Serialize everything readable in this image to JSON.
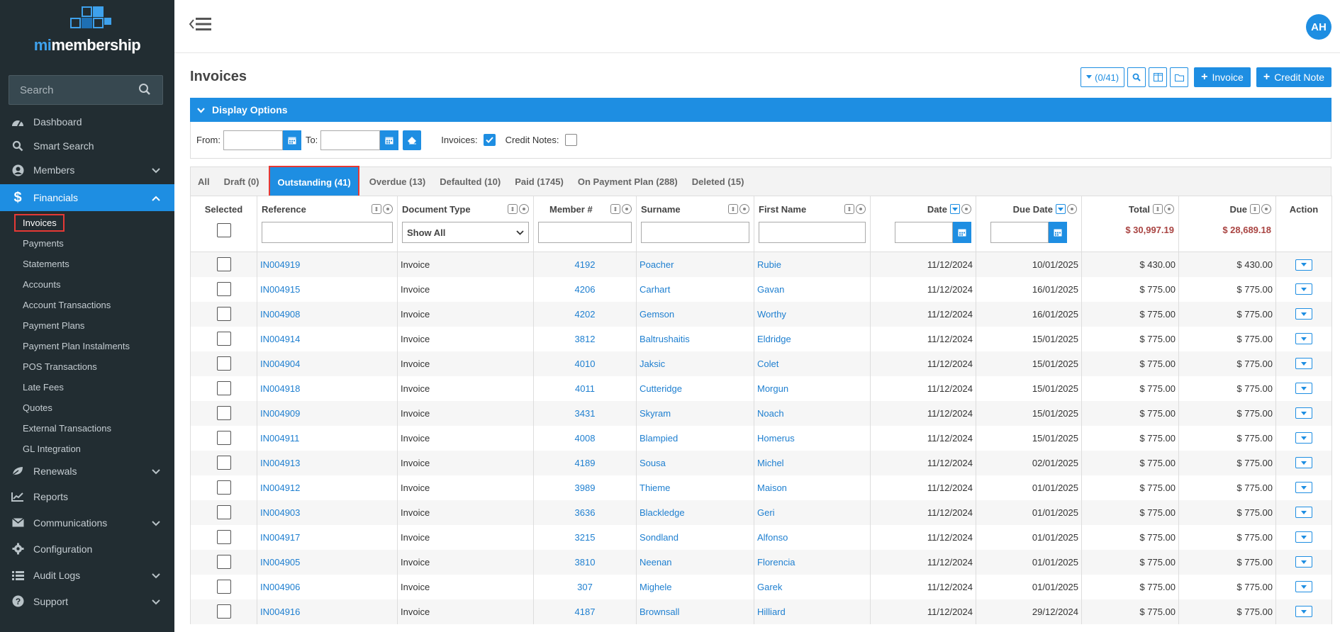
{
  "app": {
    "logo_mi": "mi",
    "logo_rest": "membership",
    "user_initials": "AH"
  },
  "search": {
    "placeholder": "Search"
  },
  "nav": {
    "dashboard": "Dashboard",
    "smart_search": "Smart Search",
    "members": "Members",
    "financials": "Financials",
    "renewals": "Renewals",
    "reports": "Reports",
    "communications": "Communications",
    "configuration": "Configuration",
    "audit_logs": "Audit Logs",
    "support": "Support",
    "financials_sub": [
      "Invoices",
      "Payments",
      "Statements",
      "Accounts",
      "Account Transactions",
      "Payment Plans",
      "Payment Plan Instalments",
      "POS Transactions",
      "Late Fees",
      "Quotes",
      "External Transactions",
      "GL Integration"
    ]
  },
  "page": {
    "title": "Invoices"
  },
  "toolbar": {
    "count_label": "(0/41)",
    "invoice_btn": "Invoice",
    "credit_note_btn": "Credit Note"
  },
  "display_options": {
    "title": "Display Options",
    "from": "From:",
    "to": "To:",
    "invoices_label": "Invoices:",
    "credit_notes_label": "Credit Notes:",
    "invoices_checked": true,
    "credit_notes_checked": false
  },
  "tabs": [
    "All",
    "Draft (0)",
    "Outstanding (41)",
    "Overdue (13)",
    "Defaulted (10)",
    "Paid (1745)",
    "On Payment Plan (288)",
    "Deleted (15)"
  ],
  "active_tab": "Outstanding (41)",
  "table": {
    "headers": {
      "selected": "Selected",
      "reference": "Reference",
      "document_type": "Document Type",
      "member": "Member #",
      "surname": "Surname",
      "first_name": "First Name",
      "date": "Date",
      "due_date": "Due Date",
      "total": "Total",
      "due": "Due",
      "action": "Action"
    },
    "document_type_filter": "Show All",
    "total_sum": "$ 30,997.19",
    "due_sum": "$ 28,689.18",
    "rows": [
      {
        "ref": "IN004919",
        "type": "Invoice",
        "member": "4192",
        "surname": "Poacher",
        "first": "Rubie",
        "date": "11/12/2024",
        "due_date": "10/01/2025",
        "total": "$ 430.00",
        "due": "$ 430.00"
      },
      {
        "ref": "IN004915",
        "type": "Invoice",
        "member": "4206",
        "surname": "Carhart",
        "first": "Gavan",
        "date": "11/12/2024",
        "due_date": "16/01/2025",
        "total": "$ 775.00",
        "due": "$ 775.00"
      },
      {
        "ref": "IN004908",
        "type": "Invoice",
        "member": "4202",
        "surname": "Gemson",
        "first": "Worthy",
        "date": "11/12/2024",
        "due_date": "16/01/2025",
        "total": "$ 775.00",
        "due": "$ 775.00"
      },
      {
        "ref": "IN004914",
        "type": "Invoice",
        "member": "3812",
        "surname": "Baltrushaitis",
        "first": "Eldridge",
        "date": "11/12/2024",
        "due_date": "15/01/2025",
        "total": "$ 775.00",
        "due": "$ 775.00"
      },
      {
        "ref": "IN004904",
        "type": "Invoice",
        "member": "4010",
        "surname": "Jaksic",
        "first": "Colet",
        "date": "11/12/2024",
        "due_date": "15/01/2025",
        "total": "$ 775.00",
        "due": "$ 775.00"
      },
      {
        "ref": "IN004918",
        "type": "Invoice",
        "member": "4011",
        "surname": "Cutteridge",
        "first": "Morgun",
        "date": "11/12/2024",
        "due_date": "15/01/2025",
        "total": "$ 775.00",
        "due": "$ 775.00"
      },
      {
        "ref": "IN004909",
        "type": "Invoice",
        "member": "3431",
        "surname": "Skyram",
        "first": "Noach",
        "date": "11/12/2024",
        "due_date": "15/01/2025",
        "total": "$ 775.00",
        "due": "$ 775.00"
      },
      {
        "ref": "IN004911",
        "type": "Invoice",
        "member": "4008",
        "surname": "Blampied",
        "first": "Homerus",
        "date": "11/12/2024",
        "due_date": "15/01/2025",
        "total": "$ 775.00",
        "due": "$ 775.00"
      },
      {
        "ref": "IN004913",
        "type": "Invoice",
        "member": "4189",
        "surname": "Sousa",
        "first": "Michel",
        "date": "11/12/2024",
        "due_date": "02/01/2025",
        "total": "$ 775.00",
        "due": "$ 775.00"
      },
      {
        "ref": "IN004912",
        "type": "Invoice",
        "member": "3989",
        "surname": "Thieme",
        "first": "Maison",
        "date": "11/12/2024",
        "due_date": "01/01/2025",
        "total": "$ 775.00",
        "due": "$ 775.00"
      },
      {
        "ref": "IN004903",
        "type": "Invoice",
        "member": "3636",
        "surname": "Blackledge",
        "first": "Geri",
        "date": "11/12/2024",
        "due_date": "01/01/2025",
        "total": "$ 775.00",
        "due": "$ 775.00"
      },
      {
        "ref": "IN004917",
        "type": "Invoice",
        "member": "3215",
        "surname": "Sondland",
        "first": "Alfonso",
        "date": "11/12/2024",
        "due_date": "01/01/2025",
        "total": "$ 775.00",
        "due": "$ 775.00"
      },
      {
        "ref": "IN004905",
        "type": "Invoice",
        "member": "3810",
        "surname": "Neenan",
        "first": "Florencia",
        "date": "11/12/2024",
        "due_date": "01/01/2025",
        "total": "$ 775.00",
        "due": "$ 775.00"
      },
      {
        "ref": "IN004906",
        "type": "Invoice",
        "member": "307",
        "surname": "Mighele",
        "first": "Garek",
        "date": "11/12/2024",
        "due_date": "01/01/2025",
        "total": "$ 775.00",
        "due": "$ 775.00"
      },
      {
        "ref": "IN004916",
        "type": "Invoice",
        "member": "4187",
        "surname": "Brownsall",
        "first": "Hilliard",
        "date": "11/12/2024",
        "due_date": "29/12/2024",
        "total": "$ 775.00",
        "due": "$ 775.00"
      }
    ]
  },
  "colors": {
    "primary": "#1e8ee2",
    "sidebar": "#222d32",
    "highlight": "#e53935",
    "sum": "#a94442",
    "link": "#1e7fd0"
  }
}
